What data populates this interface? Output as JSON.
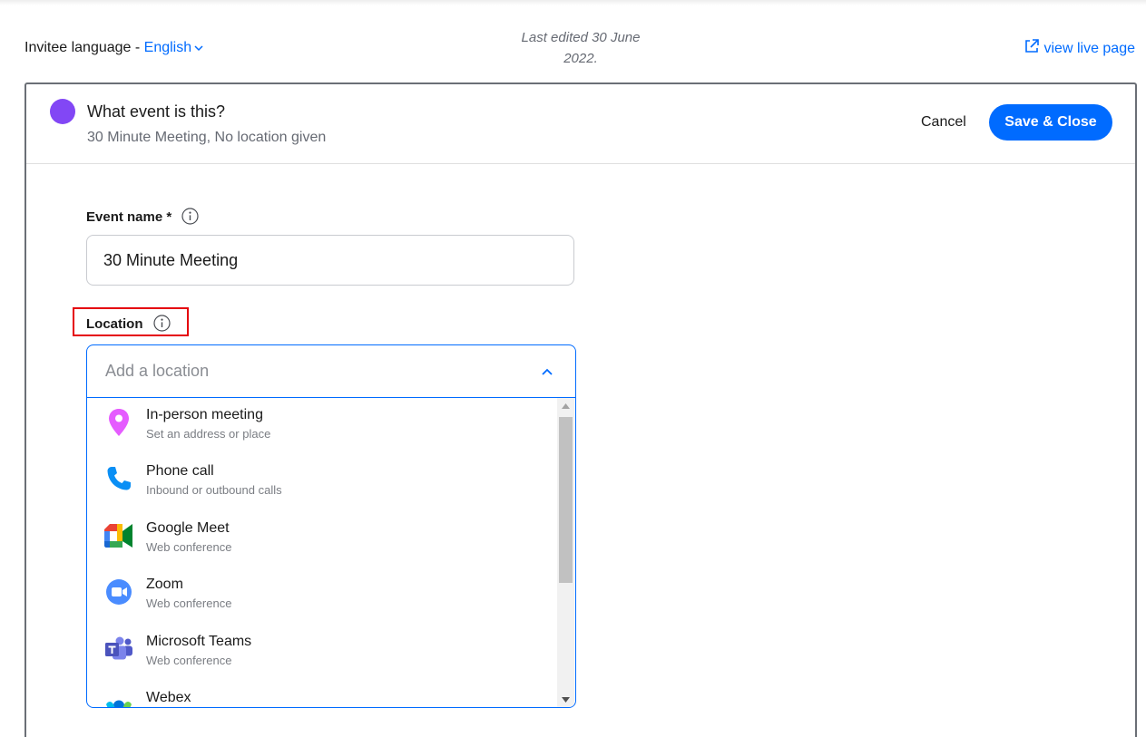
{
  "header": {
    "invitee_language_label": "Invitee language - ",
    "invitee_language_value": "English",
    "last_edited_line1": "Last edited 30 June",
    "last_edited_line2": "2022.",
    "view_live_label": "view live page"
  },
  "panel": {
    "title": "What event is this?",
    "subtitle": "30 Minute Meeting, No location given",
    "cancel_label": "Cancel",
    "save_label": "Save & Close",
    "event_color": "#8247f5"
  },
  "form": {
    "event_name_label": "Event name *",
    "event_name_value": "30 Minute Meeting",
    "location_label": "Location",
    "location_placeholder": "Add a location"
  },
  "location_options": [
    {
      "title": "In-person meeting",
      "desc": "Set an address or place",
      "icon": "map-pin-icon"
    },
    {
      "title": "Phone call",
      "desc": "Inbound or outbound calls",
      "icon": "phone-icon"
    },
    {
      "title": "Google Meet",
      "desc": "Web conference",
      "icon": "google-meet-icon"
    },
    {
      "title": "Zoom",
      "desc": "Web conference",
      "icon": "zoom-icon"
    },
    {
      "title": "Microsoft Teams",
      "desc": "Web conference",
      "icon": "microsoft-teams-icon"
    },
    {
      "title": "Webex",
      "desc": "",
      "icon": "webex-icon"
    }
  ],
  "colors": {
    "accent": "#006bff",
    "highlight_box": "#e5000b"
  }
}
